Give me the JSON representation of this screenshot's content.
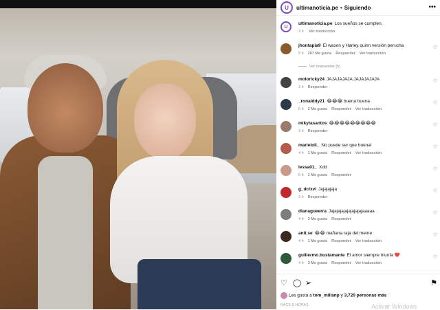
{
  "post": {
    "username": "ultimanoticia.pe",
    "follow_status": "Siguiendo",
    "avatar_text": "U",
    "caption_user": "ultimanoticia.pe",
    "caption": "Los sueños se cumplen.",
    "caption_time": "3 h",
    "caption_translate": "Ver traducción",
    "likes_prefix": "Les gusta a",
    "likes_user": "tom_millanp",
    "likes_mid": "y",
    "likes_count": "3,720 personas más",
    "time_ago": "HACE 5 HORAS",
    "watermark": "Activar Windows"
  },
  "replies_link": "Ver respuestas (5)",
  "comments": [
    {
      "user": "jhontapia9",
      "text": "El wason y Harley quinn versión perucha",
      "time": "5 h",
      "likes": "207 Me gusta",
      "reply": "Responder",
      "translate": "Ver traducción",
      "color": "#8a5a2b"
    },
    {
      "user": "moloricky24",
      "text": "JAJAJAJAJA JAJAJAJAJA",
      "time": "3 h",
      "likes": "",
      "reply": "Responder",
      "translate": "",
      "color": "#444"
    },
    {
      "user": "_ronalddy21",
      "text": "😂😂😂 buena buena",
      "time": "5 h",
      "likes": "2 Me gusta",
      "reply": "Responder",
      "translate": "Ver traducción",
      "color": "#2f3a48"
    },
    {
      "user": "mikytasantos",
      "text": "😂😂😂😂😂😂😂😂😂",
      "time": "3 h",
      "likes": "",
      "reply": "Responder",
      "translate": "",
      "color": "#9a7a6a"
    },
    {
      "user": "marieloli_",
      "text": "No puede ser que buena!",
      "time": "4 h",
      "likes": "1 Me gusta",
      "reply": "Responder",
      "translate": "Ver traducción",
      "color": "#b45a4a"
    },
    {
      "user": "lessa01_",
      "text": "Xdd",
      "time": "5 h",
      "likes": "1 Me gusta",
      "reply": "Responder",
      "translate": "",
      "color": "#c99a8a"
    },
    {
      "user": "g_dclxvi",
      "text": "Jajajajaja",
      "time": "3 h",
      "likes": "",
      "reply": "Responder",
      "translate": "",
      "color": "#c0282e"
    },
    {
      "user": "dianagueerra",
      "text": "Jajajajajajajajajajaaaaa",
      "time": "4 h",
      "likes": "3 Me gusta",
      "reply": "Responder",
      "translate": "",
      "color": "#7d7d7d"
    },
    {
      "user": "anit.se",
      "text": "😂😂 mañana raja del meme",
      "time": "4 h",
      "likes": "1 Me gusta",
      "reply": "Responder",
      "translate": "Ver traducción",
      "color": "#3a2a22"
    },
    {
      "user": "guillermo.bustamante",
      "text": "El amor siempre triunfa ❤️",
      "time": "4 h",
      "likes": "3 Me gusta",
      "reply": "Responder",
      "translate": "Ver traducción",
      "color": "#2f5a3a"
    }
  ],
  "icons": {
    "more": "more-icon",
    "heart": "heart-icon",
    "comment": "comment-icon",
    "share": "share-icon",
    "save": "bookmark-icon"
  }
}
